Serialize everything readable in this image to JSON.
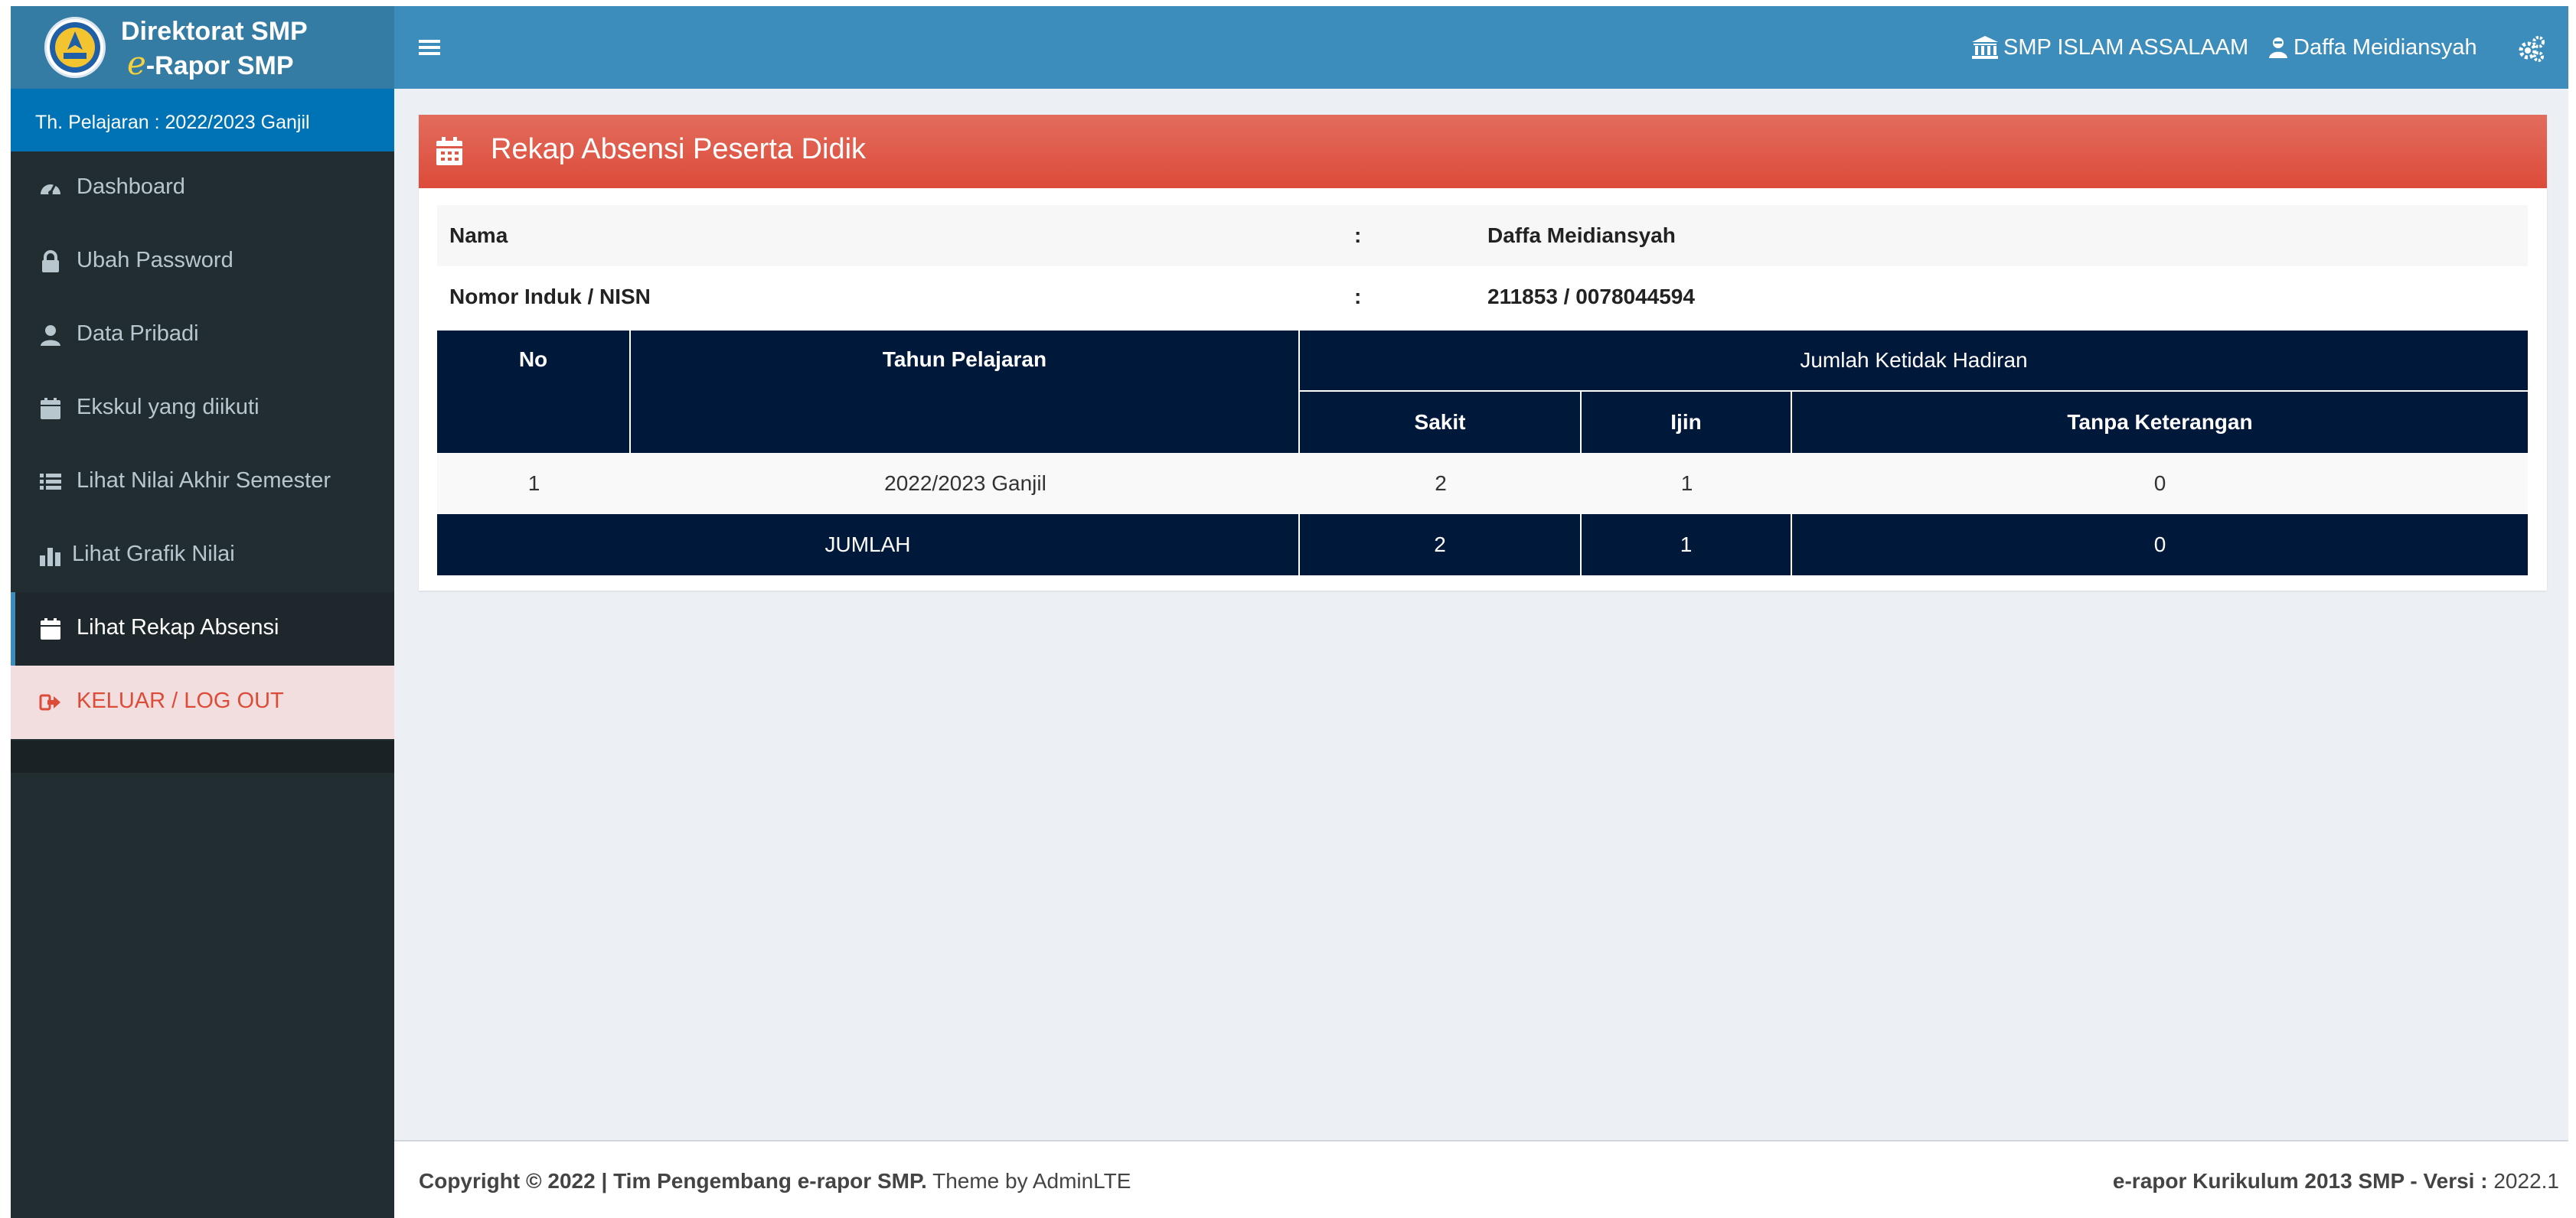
{
  "app": {
    "logo_line1": "Direktorat SMP",
    "logo_e": "e",
    "logo_line2_rest": "-Rapor SMP"
  },
  "sidebar": {
    "tahun_pelajaran": "Th. Pelajaran : 2022/2023 Ganjil",
    "items": [
      {
        "label": "Dashboard",
        "icon": "dashboard-icon"
      },
      {
        "label": "Ubah Password",
        "icon": "lock-icon"
      },
      {
        "label": "Data Pribadi",
        "icon": "user-icon"
      },
      {
        "label": "Ekskul yang diikuti",
        "icon": "calendar-icon"
      },
      {
        "label": "Lihat Nilai Akhir Semester",
        "icon": "list-icon"
      },
      {
        "label": "Lihat Grafik Nilai",
        "icon": "bar-chart-icon"
      },
      {
        "label": "Lihat Rekap Absensi",
        "icon": "calendar-icon",
        "active": true
      },
      {
        "label": "KELUAR / LOG OUT",
        "icon": "sign-out-icon"
      }
    ]
  },
  "header": {
    "school": "SMP ISLAM ASSALAAM",
    "user": "Daffa Meidiansyah"
  },
  "box": {
    "title": "Rekap Absensi Peserta Didik",
    "info": [
      {
        "label": "Nama",
        "colon": ":",
        "value": "Daffa Meidiansyah"
      },
      {
        "label": "Nomor Induk / NISN",
        "colon": ":",
        "value": "211853 / 0078044594"
      }
    ],
    "table": {
      "headers": {
        "no": "No",
        "tahun": "Tahun Pelajaran",
        "group": "Jumlah Ketidak Hadiran",
        "sakit": "Sakit",
        "ijin": "Ijin",
        "tanpa": "Tanpa Keterangan"
      },
      "rows": [
        {
          "no": "1",
          "tahun": "2022/2023 Ganjil",
          "sakit": "2",
          "ijin": "1",
          "tanpa": "0"
        }
      ],
      "total": {
        "label": "JUMLAH",
        "sakit": "2",
        "ijin": "1",
        "tanpa": "0"
      }
    }
  },
  "footer": {
    "copyright_bold": "Copyright © 2022 | Tim Pengembang e-rapor SMP.",
    "theme": " Theme by AdminLTE",
    "version_bold": "e-rapor Kurikulum 2013 SMP - Versi :",
    "version": " 2022.1"
  },
  "colors": {
    "header": "#3c8dbc",
    "sidebar": "#222d32",
    "box_header": "#dd4b39",
    "table_header": "#00183a"
  }
}
